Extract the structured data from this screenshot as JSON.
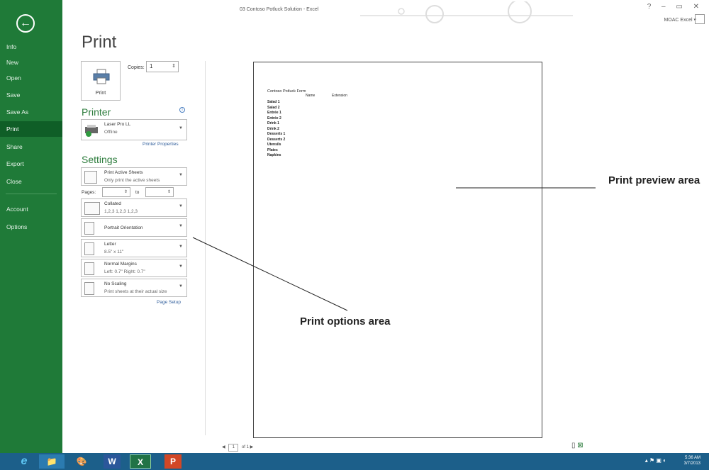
{
  "window": {
    "title": "03 Contoso Potluck Solution - Excel",
    "controls": "? – ▭ ✕",
    "account": "MOAC Excel ▾"
  },
  "nav": {
    "back_glyph": "←",
    "items": [
      "Info",
      "New",
      "Open",
      "Save",
      "Save As",
      "Print",
      "Share",
      "Export",
      "Close",
      "Account",
      "Options"
    ],
    "selected": "Print"
  },
  "page_title": "Print",
  "print_button": {
    "label": "Print"
  },
  "copies": {
    "label": "Copies:",
    "value": "1"
  },
  "printer": {
    "heading": "Printer",
    "name": "Laser Pro LL",
    "status": "Offline",
    "properties_link": "Printer Properties"
  },
  "settings": {
    "heading": "Settings",
    "what": {
      "title": "Print Active Sheets",
      "sub": "Only print the active sheets"
    },
    "pages_label": "Pages:",
    "to_label": "to",
    "collate": {
      "title": "Collated",
      "sub": "1,2,3   1,2,3   1,2,3"
    },
    "orientation": {
      "title": "Portrait Orientation"
    },
    "paper": {
      "title": "Letter",
      "sub": "8.5\" x 11\""
    },
    "margins": {
      "title": "Normal Margins",
      "sub": "Left: 0.7\"   Right: 0.7\""
    },
    "scaling": {
      "title": "No Scaling",
      "sub": "Print sheets at their actual size"
    },
    "page_setup_link": "Page Setup"
  },
  "preview": {
    "title": "Contoso Potluck Form",
    "col_name": "Name",
    "col_ext": "Extension",
    "rows": [
      "Salad 1",
      "Salad 2",
      "Entrée 1",
      "Entrée 2",
      "Drink 1",
      "Drink 2",
      "Desserts 1",
      "Desserts 2",
      "Utensils",
      "Plates",
      "Napkins"
    ]
  },
  "pager": {
    "prev": "◀",
    "current": "1",
    "of": "of 1",
    "next": "▶"
  },
  "taskbar": {
    "apps": [
      "e",
      "📁",
      "🎨",
      "W",
      "X",
      "P"
    ],
    "time": "5:36 AM",
    "date": "3/7/2013"
  },
  "callouts": {
    "preview": "Print preview area",
    "options": "Print options area"
  }
}
